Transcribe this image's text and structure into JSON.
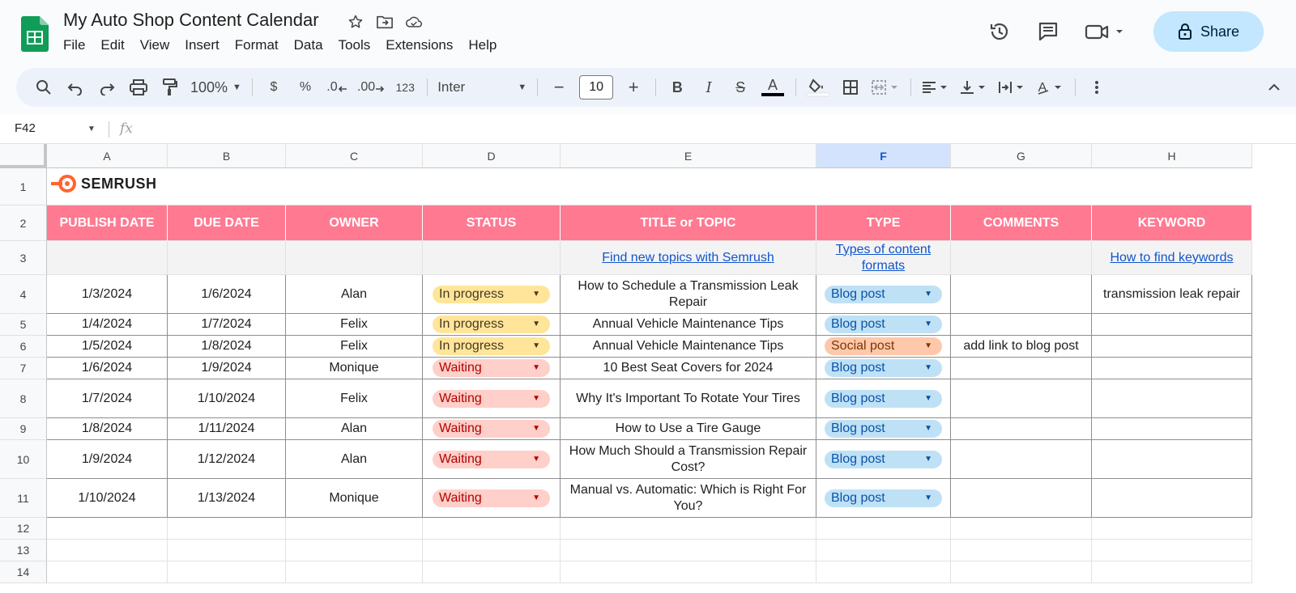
{
  "app": {
    "doc_title": "My Auto Shop Content Calendar",
    "menu": [
      "File",
      "Edit",
      "View",
      "Insert",
      "Format",
      "Data",
      "Tools",
      "Extensions",
      "Help"
    ],
    "share_label": "Share"
  },
  "toolbar": {
    "zoom": "100%",
    "currency": "$",
    "percent": "%",
    "dec_decrease": ".0",
    "dec_increase": ".00",
    "number_format": "123",
    "font": "Inter",
    "font_size": "10"
  },
  "formula_bar": {
    "name_box": "F42",
    "fx": "fx"
  },
  "sheet": {
    "selected_column": "F",
    "columns": [
      "A",
      "B",
      "C",
      "D",
      "E",
      "F",
      "G",
      "H"
    ],
    "row_numbers": [
      "1",
      "2",
      "3",
      "4",
      "5",
      "6",
      "7",
      "8",
      "9",
      "10",
      "11",
      "12",
      "13",
      "14"
    ],
    "brand": "SEMRUSH",
    "headers": [
      "PUBLISH DATE",
      "DUE DATE",
      "OWNER",
      "STATUS",
      "TITLE or TOPIC",
      "TYPE",
      "COMMENTS",
      "KEYWORD"
    ],
    "helper_links": {
      "title": "Find new topics with Semrush",
      "type": "Types of content formats",
      "keyword": "How to find keywords"
    },
    "rows": [
      {
        "publish": "1/3/2024",
        "due": "1/6/2024",
        "owner": "Alan",
        "status": "In progress",
        "title": "How to Schedule a Transmission Leak Repair",
        "type": "Blog post",
        "comments": "",
        "keyword": "transmission leak repair"
      },
      {
        "publish": "1/4/2024",
        "due": "1/7/2024",
        "owner": "Felix",
        "status": "In progress",
        "title": "Annual Vehicle Maintenance Tips",
        "type": "Blog post",
        "comments": "",
        "keyword": ""
      },
      {
        "publish": "1/5/2024",
        "due": "1/8/2024",
        "owner": "Felix",
        "status": "In progress",
        "title": "Annual Vehicle Maintenance Tips",
        "type": "Social post",
        "comments": "add link to blog post",
        "keyword": ""
      },
      {
        "publish": "1/6/2024",
        "due": "1/9/2024",
        "owner": "Monique",
        "status": "Waiting",
        "title": "10 Best Seat Covers for 2024",
        "type": "Blog post",
        "comments": "",
        "keyword": ""
      },
      {
        "publish": "1/7/2024",
        "due": "1/10/2024",
        "owner": "Felix",
        "status": "Waiting",
        "title": "Why It's Important To Rotate Your Tires",
        "type": "Blog post",
        "comments": "",
        "keyword": ""
      },
      {
        "publish": "1/8/2024",
        "due": "1/11/2024",
        "owner": "Alan",
        "status": "Waiting",
        "title": "How to Use a Tire Gauge",
        "type": "Blog post",
        "comments": "",
        "keyword": ""
      },
      {
        "publish": "1/9/2024",
        "due": "1/12/2024",
        "owner": "Alan",
        "status": "Waiting",
        "title": "How Much Should a Transmission Repair Cost?",
        "type": "Blog post",
        "comments": "",
        "keyword": ""
      },
      {
        "publish": "1/10/2024",
        "due": "1/13/2024",
        "owner": "Monique",
        "status": "Waiting",
        "title": "Manual vs. Automatic: Which is Right For You?",
        "type": "Blog post",
        "comments": "",
        "keyword": ""
      }
    ]
  },
  "colors": {
    "header_pink": "#ff7a91",
    "share_bg": "#c2e7ff",
    "selected_col": "#d3e3fd",
    "link": "#1155cc",
    "sheets_green": "#0f9d58",
    "semrush_orange": "#ff642d"
  }
}
